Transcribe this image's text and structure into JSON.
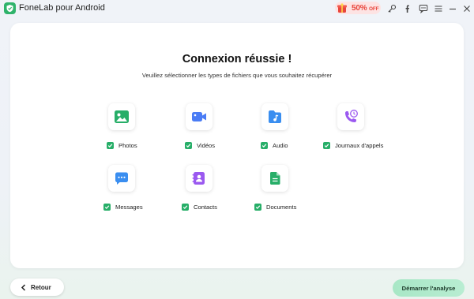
{
  "window": {
    "title": "FoneLab pour Android",
    "promo": {
      "percent": "50%",
      "suffix": "OFF"
    }
  },
  "main": {
    "heading": "Connexion réussie !",
    "subheading": "Veuillez sélectionner les types de fichiers que vous souhaitez récupérer",
    "file_types": [
      {
        "label": "Photos",
        "checked": true,
        "icon": "photo-icon",
        "color": "#27ae68"
      },
      {
        "label": "Vidéos",
        "checked": true,
        "icon": "video-icon",
        "color": "#4a7cf5"
      },
      {
        "label": "Audio",
        "checked": true,
        "icon": "audio-icon",
        "color": "#3a8ef0"
      },
      {
        "label": "Journaux d'appels",
        "checked": true,
        "icon": "call-log-icon",
        "color": "#9b59f0"
      },
      {
        "label": "Messages",
        "checked": true,
        "icon": "message-icon",
        "color": "#3a8ef0"
      },
      {
        "label": "Contacts",
        "checked": true,
        "icon": "contacts-icon",
        "color": "#9b59f0"
      },
      {
        "label": "Documents",
        "checked": true,
        "icon": "document-icon",
        "color": "#27ae68"
      }
    ]
  },
  "footer": {
    "back_label": "Retour",
    "start_label": "Démarrer l'analyse"
  },
  "colors": {
    "accent_green": "#27ae68",
    "start_button": "#b0eacb",
    "promo_red": "#e8453c"
  }
}
